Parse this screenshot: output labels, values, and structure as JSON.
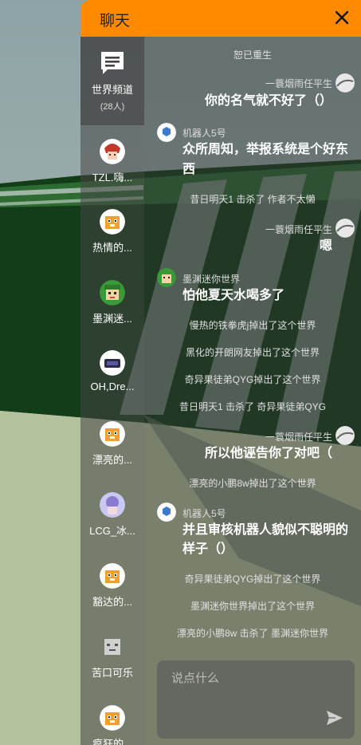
{
  "header": {
    "title": "聊天"
  },
  "sidebar": {
    "channel": {
      "label": "世界频道",
      "count": "(28人)"
    },
    "users": [
      {
        "label": "TZL.嗨..."
      },
      {
        "label": "热情的..."
      },
      {
        "label": "墨渊迷..."
      },
      {
        "label": "OH,Dre..."
      },
      {
        "label": "漂亮的..."
      },
      {
        "label": "LCG_冰..."
      },
      {
        "label": "豁达的..."
      },
      {
        "label": "苦口可乐"
      },
      {
        "label": "疯狂的..."
      }
    ]
  },
  "messages": {
    "m0": {
      "text": "恕已重生"
    },
    "m1": {
      "name": "一蓑烟雨任平生",
      "text": "你的名气就不好了（）"
    },
    "m2": {
      "name": "机器人5号",
      "text1": "众所周知，举报系统是个好东",
      "text2": "西"
    },
    "m3": {
      "text": "昔日明天1 击杀了 作者不太懒"
    },
    "m4": {
      "name": "一蓑烟雨任平生",
      "text": "嗯"
    },
    "m5": {
      "name": "墨渊迷你世界",
      "text": "怕他夏天水喝多了"
    },
    "m6": {
      "text": "慢热的铁拳虎j掉出了这个世界"
    },
    "m7": {
      "text": "黑化的开朗网友掉出了这个世界"
    },
    "m8": {
      "text": "奇异果徒弟QYG掉出了这个世界"
    },
    "m9": {
      "text": "昔日明天1 击杀了 奇异果徒弟QYG"
    },
    "m10": {
      "name": "一蓑烟雨任平生",
      "text": "所以他诬告你了对吧（"
    },
    "m11": {
      "text": "漂亮的小鹏8w掉出了这个世界"
    },
    "m12": {
      "name": "机器人5号",
      "text1": "并且审核机器人貌似不聪明的",
      "text2": "样子（）"
    },
    "m13": {
      "text": "奇异果徒弟QYG掉出了这个世界"
    },
    "m14": {
      "text": "墨渊迷你世界掉出了这个世界"
    },
    "m15": {
      "text": "漂亮的小鹏8w 击杀了 墨渊迷你世界"
    }
  },
  "input": {
    "placeholder": "说点什么"
  },
  "colors": {
    "header": "#ff8a00"
  },
  "icons": {
    "close": "close-icon",
    "channel": "chat-icon",
    "send": "send-icon"
  }
}
